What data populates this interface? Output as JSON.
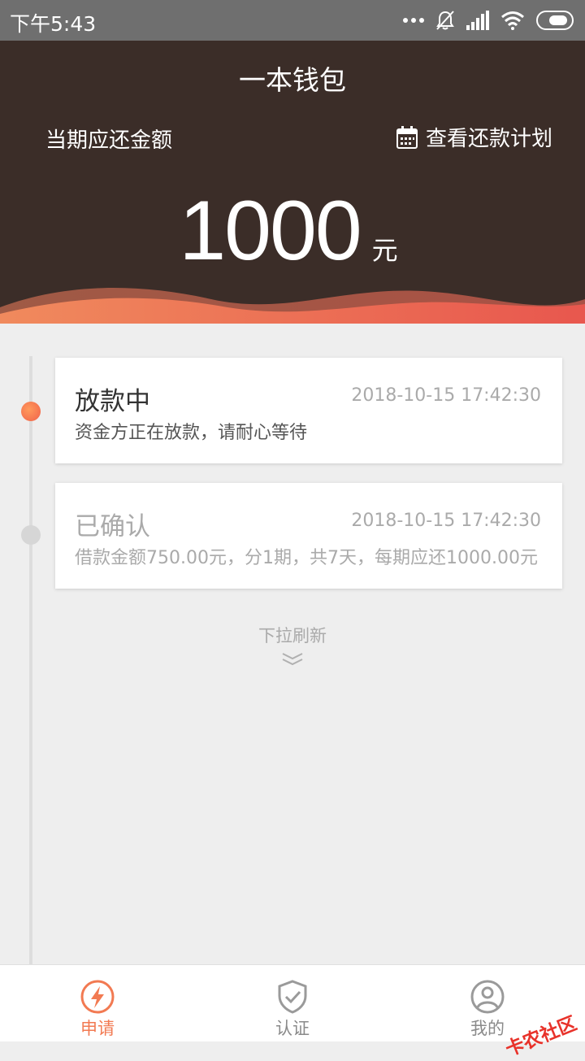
{
  "status_bar": {
    "time": "下午5:43"
  },
  "header": {
    "title": "一本钱包",
    "due_label": "当期应还金额",
    "plan_link": "查看还款计划",
    "amount": "1000",
    "unit": "元"
  },
  "timeline": [
    {
      "title": "放款中",
      "time": "2018-10-15 17:42:30",
      "desc": "资金方正在放款，请耐心等待",
      "state": "active"
    },
    {
      "title": "已确认",
      "time": "2018-10-15 17:42:30",
      "desc": "借款金额750.00元，分1期，共7天，每期应还1000.00元",
      "state": "done"
    }
  ],
  "pull_hint": "下拉刷新",
  "tabs": [
    {
      "label": "申请",
      "icon": "lightning-icon",
      "active": true
    },
    {
      "label": "认证",
      "icon": "shield-check-icon",
      "active": false
    },
    {
      "label": "我的",
      "icon": "user-icon",
      "active": false
    }
  ],
  "watermark": "卡农社区",
  "colors": {
    "header_bg": "#3b2d28",
    "accent": "#f27a52",
    "background": "#eeeeee"
  }
}
